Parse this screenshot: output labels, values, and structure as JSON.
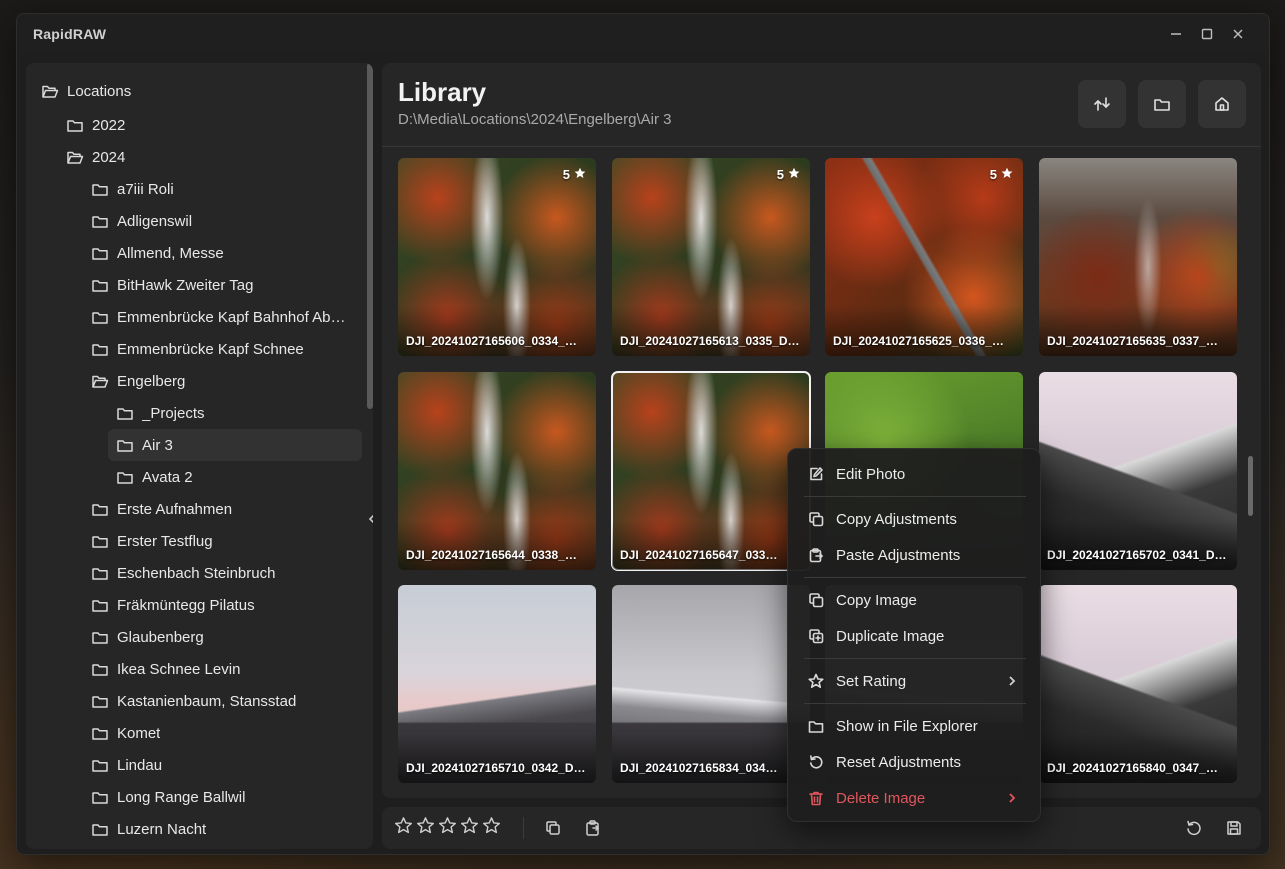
{
  "app": {
    "title": "RapidRAW"
  },
  "sidebar": {
    "items": [
      {
        "label": "Locations",
        "level": 0,
        "open": true
      },
      {
        "label": "2022",
        "level": 1,
        "open": false
      },
      {
        "label": "2024",
        "level": 1,
        "open": true
      },
      {
        "label": "a7iii Roli",
        "level": 2,
        "open": false
      },
      {
        "label": "Adligenswil",
        "level": 2,
        "open": false
      },
      {
        "label": "Allmend, Messe",
        "level": 2,
        "open": false
      },
      {
        "label": "BitHawk Zweiter Tag",
        "level": 2,
        "open": false
      },
      {
        "label": "Emmenbrücke Kapf Bahnhof Ab…",
        "level": 2,
        "open": false
      },
      {
        "label": "Emmenbrücke Kapf Schnee",
        "level": 2,
        "open": false
      },
      {
        "label": "Engelberg",
        "level": 2,
        "open": true
      },
      {
        "label": "_Projects",
        "level": 3,
        "open": false
      },
      {
        "label": "Air 3",
        "level": 3,
        "open": false,
        "selected": true
      },
      {
        "label": "Avata 2",
        "level": 3,
        "open": false
      },
      {
        "label": "Erste Aufnahmen",
        "level": 2,
        "open": false
      },
      {
        "label": "Erster Testflug",
        "level": 2,
        "open": false
      },
      {
        "label": "Eschenbach Steinbruch",
        "level": 2,
        "open": false
      },
      {
        "label": "Fräkmüntegg Pilatus",
        "level": 2,
        "open": false
      },
      {
        "label": "Glaubenberg",
        "level": 2,
        "open": false
      },
      {
        "label": "Ikea Schnee Levin",
        "level": 2,
        "open": false
      },
      {
        "label": "Kastanienbaum, Stansstad",
        "level": 2,
        "open": false
      },
      {
        "label": "Komet",
        "level": 2,
        "open": false
      },
      {
        "label": "Lindau",
        "level": 2,
        "open": false
      },
      {
        "label": "Long Range Ballwil",
        "level": 2,
        "open": false
      },
      {
        "label": "Luzern Nacht",
        "level": 2,
        "open": false
      }
    ]
  },
  "library": {
    "title": "Library",
    "path": "D:\\Media\\Locations\\2024\\Engelberg\\Air 3",
    "header_buttons": [
      "sort-icon",
      "folder-icon",
      "home-icon"
    ]
  },
  "thumbnails": [
    {
      "name": "DJI_20241027165606_0334_…",
      "rating": "5",
      "img": "river"
    },
    {
      "name": "DJI_20241027165613_0335_D…",
      "rating": "5",
      "img": "river"
    },
    {
      "name": "DJI_20241027165625_0336_…",
      "rating": "5",
      "img": "road"
    },
    {
      "name": "DJI_20241027165635_0337_…",
      "rating": "",
      "img": "valley"
    },
    {
      "name": "DJI_20241027165644_0338_…",
      "rating": "",
      "img": "river"
    },
    {
      "name": "DJI_20241027165647_033…",
      "rating": "",
      "img": "river",
      "selected": true
    },
    {
      "name": "",
      "rating": "",
      "img": "meadow"
    },
    {
      "name": "DJI_20241027165702_0341_D…",
      "rating": "",
      "img": "mountain"
    },
    {
      "name": "DJI_20241027165710_0342_D…",
      "rating": "",
      "img": "peaks"
    },
    {
      "name": "DJI_20241027165834_034…",
      "rating": "",
      "img": "peaks2"
    },
    {
      "name": "",
      "rating": "",
      "img": "peaks2"
    },
    {
      "name": "DJI_20241027165840_0347_…",
      "rating": "",
      "img": "mountain"
    }
  ],
  "context_menu": {
    "groups": [
      [
        {
          "label": "Edit Photo",
          "icon": "edit-icon"
        }
      ],
      [
        {
          "label": "Copy Adjustments",
          "icon": "copy-icon"
        },
        {
          "label": "Paste Adjustments",
          "icon": "paste-icon"
        }
      ],
      [
        {
          "label": "Copy Image",
          "icon": "copy-icon"
        },
        {
          "label": "Duplicate Image",
          "icon": "duplicate-icon"
        }
      ],
      [
        {
          "label": "Set Rating",
          "icon": "star-icon",
          "submenu": true
        }
      ],
      [
        {
          "label": "Show in File Explorer",
          "icon": "folder-icon"
        },
        {
          "label": "Reset Adjustments",
          "icon": "reset-icon"
        },
        {
          "label": "Delete Image",
          "icon": "trash-icon",
          "submenu": true,
          "danger": true
        }
      ]
    ]
  },
  "bottom_bar": {
    "stars": 5,
    "actions_left": [
      "copy-icon",
      "paste-icon"
    ],
    "actions_right": [
      "reset-icon",
      "save-icon"
    ]
  },
  "colors": {
    "accent_danger": "#e0565d",
    "panel": "#262626",
    "window": "#1e1e1e"
  }
}
